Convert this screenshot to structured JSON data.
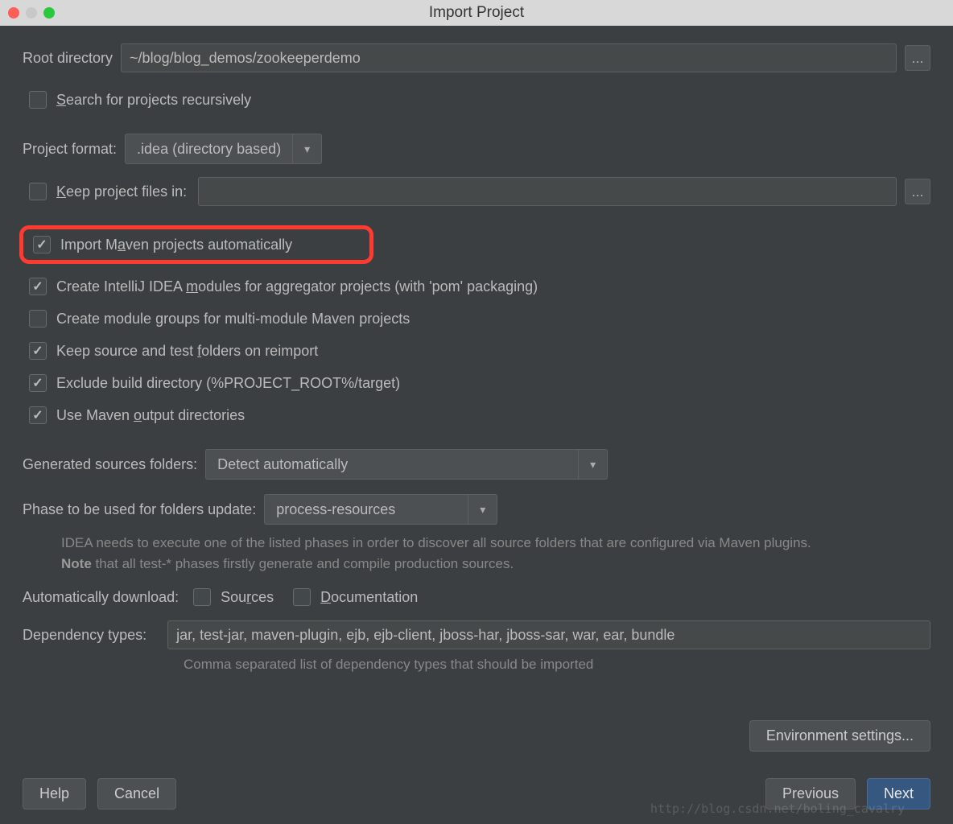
{
  "window": {
    "title": "Import Project"
  },
  "root": {
    "label": "Root directory",
    "value": "~/blog/blog_demos/zookeeperdemo",
    "browse": "..."
  },
  "search": {
    "label": "Search for projects recursively"
  },
  "format": {
    "label": "Project format:",
    "value": ".idea (directory based)"
  },
  "keep": {
    "label": "Keep project files in:",
    "browse": "..."
  },
  "importAuto": {
    "label_pre": "Import M",
    "label_u": "a",
    "label_post": "ven projects automatically"
  },
  "createModules": {
    "label_pre": "Create IntelliJ IDEA ",
    "label_u": "m",
    "label_post": "odules for aggregator projects (with 'pom' packaging)"
  },
  "createGroups": {
    "label_pre": "Create module ",
    "label_u": "g",
    "label_post": "roups for multi-module Maven projects"
  },
  "keepSource": {
    "label_pre": "Keep source and test ",
    "label_u": "f",
    "label_post": "olders on reimport"
  },
  "exclude": {
    "label": "Exclude build directory (%PROJECT_ROOT%/target)"
  },
  "useOutput": {
    "label_pre": "Use Maven ",
    "label_u": "o",
    "label_post": "utput directories"
  },
  "genSources": {
    "label": "Generated sources folders:",
    "value": "Detect automatically"
  },
  "phase": {
    "label": "Phase to be used for folders update:",
    "value": "process-resources"
  },
  "phaseHint": {
    "line1": "IDEA needs to execute one of the listed phases in order to discover all source folders that are configured via Maven plugins.",
    "note": "Note",
    "line2": " that all test-* phases firstly generate and compile production sources."
  },
  "autoDownload": {
    "label": "Automatically download:",
    "sources_pre": "Sou",
    "sources_u": "r",
    "sources_post": "ces",
    "docs_u": "D",
    "docs_post": "ocumentation"
  },
  "dep": {
    "label": "Dependency types:",
    "value": "jar, test-jar, maven-plugin, ejb, ejb-client, jboss-har, jboss-sar, war, ear, bundle",
    "hint": "Comma separated list of dependency types that should be imported"
  },
  "env": {
    "label": "Environment settings..."
  },
  "buttons": {
    "help": "Help",
    "cancel": "Cancel",
    "previous": "Previous",
    "next": "Next"
  },
  "watermark": "http://blog.csdn.net/boling_cavalry"
}
